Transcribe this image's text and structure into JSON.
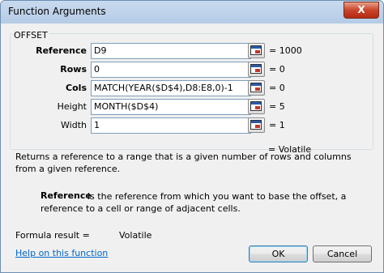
{
  "window": {
    "title": "Function Arguments",
    "close_glyph": "X"
  },
  "function_name": "OFFSET",
  "arguments": [
    {
      "label": "Reference",
      "bold": true,
      "value": "D9",
      "result": "= 1000"
    },
    {
      "label": "Rows",
      "bold": true,
      "value": "0",
      "result": "= 0"
    },
    {
      "label": "Cols",
      "bold": true,
      "value": "MATCH(YEAR($D$4),D8:E8,0)-1",
      "result": "= 0"
    },
    {
      "label": "Height",
      "bold": false,
      "value": "MONTH($D$4)",
      "result": "= 5"
    },
    {
      "label": "Width",
      "bold": false,
      "value": "1",
      "result": "= 1"
    }
  ],
  "function_result": "= Volatile",
  "description": "Returns a reference to a range that is a given number of rows and columns from a given reference.",
  "argument_help": {
    "name": "Reference",
    "text": "is the reference from which you want to base the offset, a reference to a cell or range of adjacent cells."
  },
  "formula_result": {
    "label": "Formula result =",
    "value": "Volatile"
  },
  "help_link": "Help on this function",
  "buttons": {
    "ok": "OK",
    "cancel": "Cancel"
  },
  "icons": {
    "collapse": "range-collapse-icon"
  },
  "colors": {
    "titlebar": "#b5cbe6",
    "close": "#c8442a",
    "link": "#0066cc"
  }
}
